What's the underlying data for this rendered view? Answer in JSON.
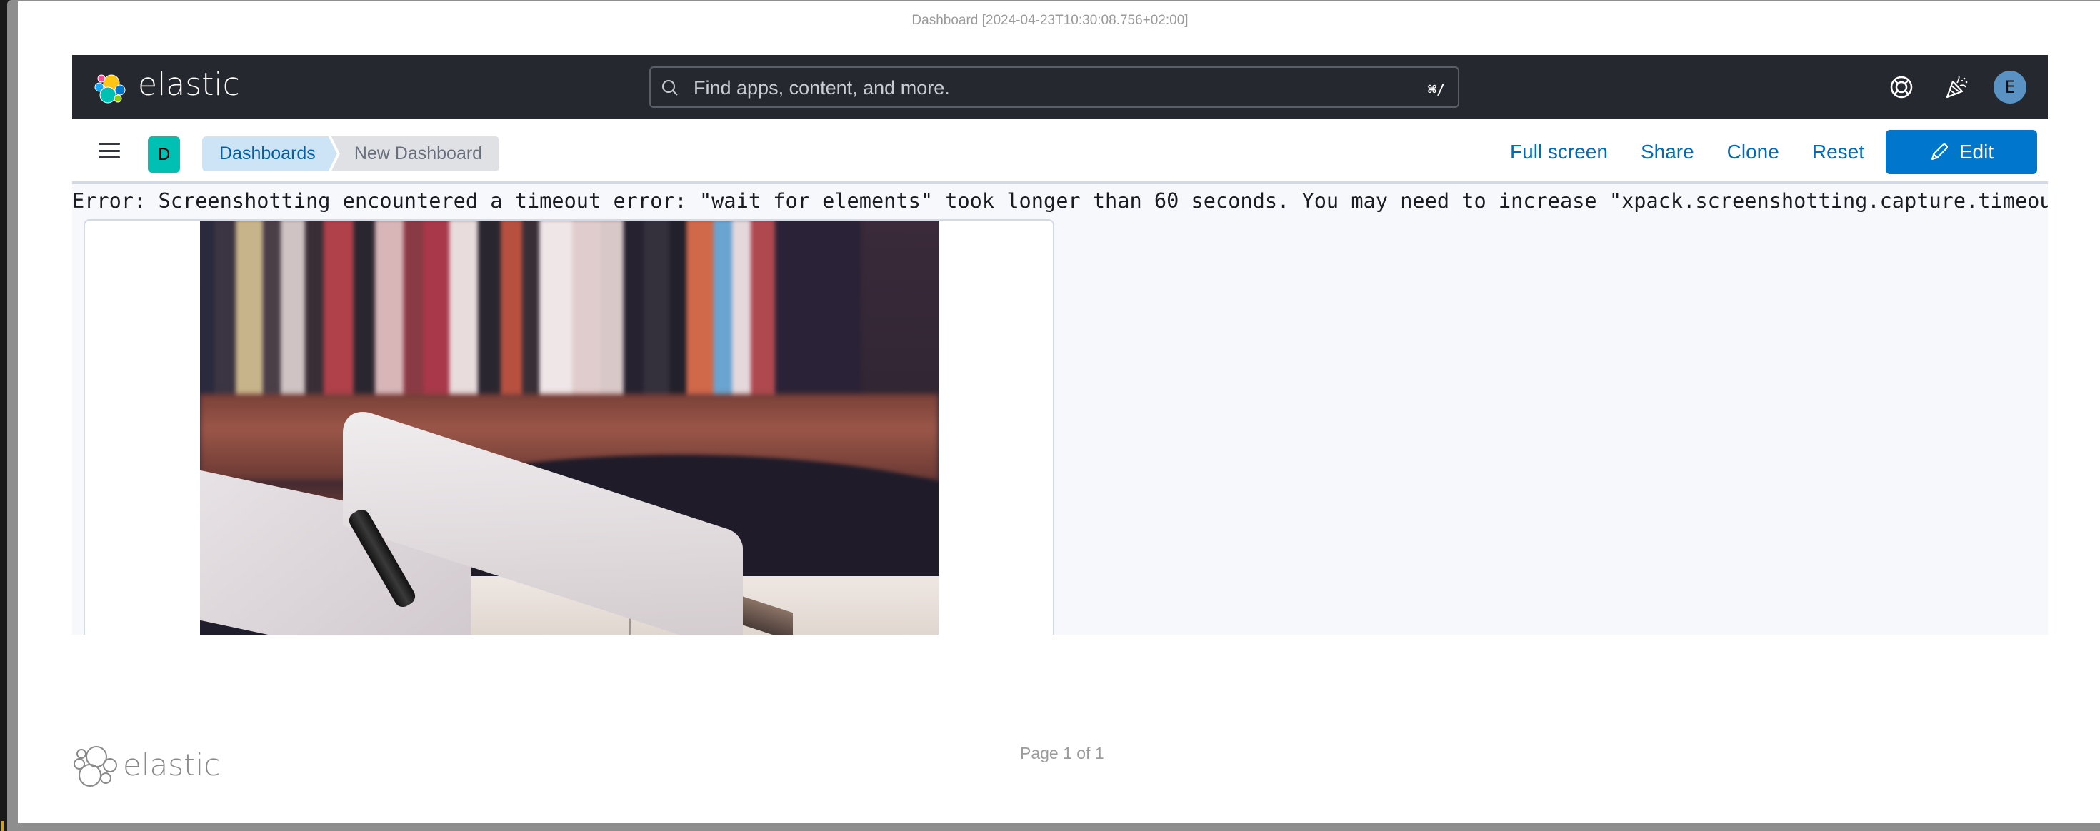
{
  "document": {
    "title": "Dashboard [2024-04-23T10:30:08.756+02:00]"
  },
  "header": {
    "brand": "elastic",
    "search": {
      "placeholder": "Find apps, content, and more.",
      "shortcut": "⌘/"
    },
    "icons": [
      "help-icon",
      "whats-new-icon"
    ],
    "user_initial": "E",
    "colors": {
      "background": "#25282f",
      "avatar": "#5a93c3"
    }
  },
  "navbar": {
    "space_initial": "D",
    "breadcrumbs": [
      {
        "label": "Dashboards"
      },
      {
        "label": "New Dashboard"
      }
    ],
    "actions": [
      {
        "label": "Full screen"
      },
      {
        "label": "Share"
      },
      {
        "label": "Clone"
      },
      {
        "label": "Reset"
      }
    ],
    "edit_label": "Edit",
    "colors": {
      "space_badge": "#00bfb3",
      "link": "#006bb8",
      "primary_button": "#0077cc"
    }
  },
  "content": {
    "error_message": "Error: Screenshotting encountered a timeout error: \"wait for elements\" took longer than 60 seconds. You may need to increase \"xpack.screenshotting.capture.timeouts.waitForEle",
    "panel_image_description": "Open book with a pen in front of a blurred bookshelf"
  },
  "footer": {
    "brand": "elastic",
    "page_label": "Page 1 of 1"
  }
}
